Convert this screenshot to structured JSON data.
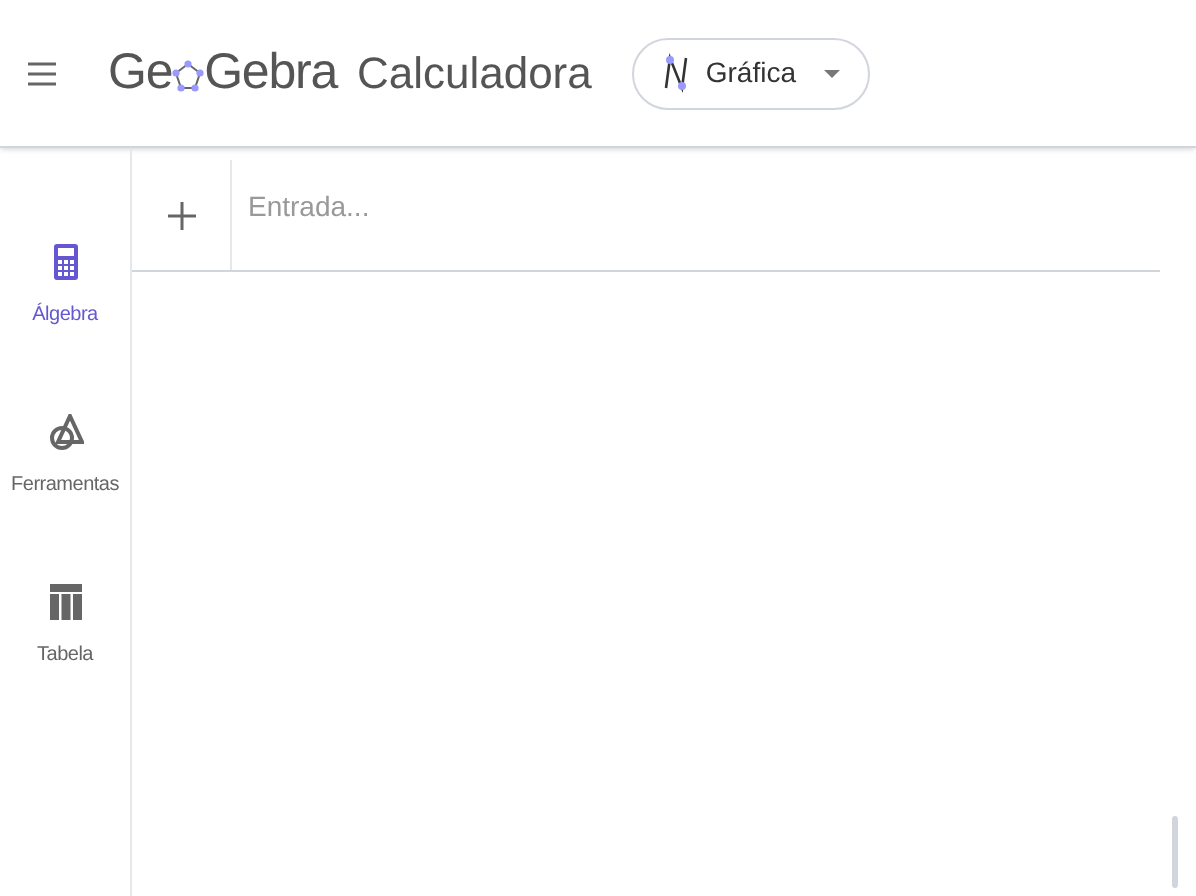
{
  "header": {
    "logo_start": "Ge",
    "logo_end": "Gebra",
    "app_name": "Calculadora",
    "app_switch": {
      "label": "Gráfica"
    }
  },
  "sidebar": {
    "items": [
      {
        "kind": "calculator",
        "label": "Álgebra",
        "selected": true
      },
      {
        "kind": "tools",
        "label": "Ferramentas",
        "selected": false
      },
      {
        "kind": "table",
        "label": "Tabela",
        "selected": false
      }
    ]
  },
  "algebra": {
    "input": {
      "placeholder": "Entrada..."
    }
  }
}
